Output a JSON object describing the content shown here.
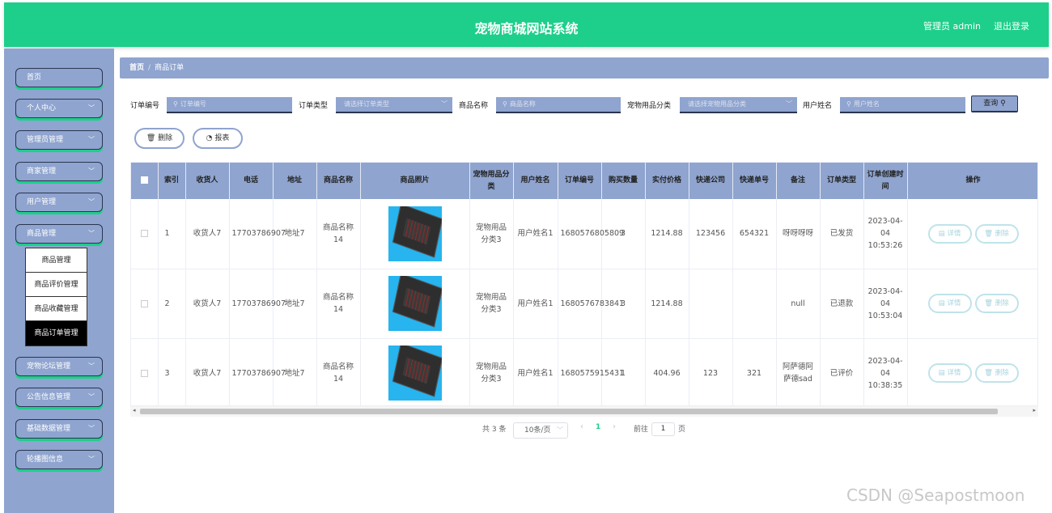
{
  "header": {
    "title": "宠物商城网站系统",
    "user": "管理员 admin",
    "logout": "退出登录"
  },
  "sidebar": {
    "items": [
      {
        "label": "首页",
        "chevron": ""
      },
      {
        "label": "个人中心",
        "chevron": "﹀"
      },
      {
        "label": "管理员管理",
        "chevron": "﹀"
      },
      {
        "label": "商家管理",
        "chevron": "﹀"
      },
      {
        "label": "用户管理",
        "chevron": "﹀"
      },
      {
        "label": "商品管理",
        "chevron": "﹀"
      },
      {
        "label": "宠物论坛管理",
        "chevron": "﹀"
      },
      {
        "label": "公告信息管理",
        "chevron": "﹀"
      },
      {
        "label": "基础数据管理",
        "chevron": "﹀"
      },
      {
        "label": "轮播图信息",
        "chevron": "﹀"
      }
    ],
    "submenu": [
      "商品管理",
      "商品评价管理",
      "商品收藏管理",
      "商品订单管理"
    ]
  },
  "breadcrumb": {
    "home": "首页",
    "sep": "/",
    "current": "商品订单"
  },
  "filters": {
    "order_no_label": "订单编号",
    "order_no_placeholder": "订单编号",
    "order_type_label": "订单类型",
    "order_type_placeholder": "请选择订单类型",
    "product_name_label": "商品名称",
    "product_name_placeholder": "商品名称",
    "category_label": "宠物用品分类",
    "category_placeholder": "请选择宠物用品分类",
    "username_label": "用户姓名",
    "username_placeholder": "用户姓名",
    "query_label": "查询",
    "search_icon": "⚲",
    "dropdown_icon": "﹀"
  },
  "actions": {
    "delete_label": "删除",
    "delete_icon": "🗑",
    "report_label": "报表",
    "report_icon": "◔"
  },
  "table": {
    "headers": [
      "索引",
      "收货人",
      "电话",
      "地址",
      "商品名称",
      "商品照片",
      "宠物用品分类",
      "用户姓名",
      "订单编号",
      "购买数量",
      "实付价格",
      "快递公司",
      "快递单号",
      "备注",
      "订单类型",
      "订单创建时间",
      "操作"
    ],
    "rows": [
      {
        "index": "1",
        "receiver": "收货人7",
        "phone": "17703786907",
        "address": "地址7",
        "product": "商品名称14",
        "category": "宠物用品分类3",
        "username": "用户姓名1",
        "order_no": "1680576805809",
        "qty": "3",
        "price": "1214.88",
        "courier": "123456",
        "tracking": "654321",
        "note": "呀呀呀呀",
        "type": "已发货",
        "created": "2023-04-04 10:53:26"
      },
      {
        "index": "2",
        "receiver": "收货人7",
        "phone": "17703786907",
        "address": "地址7",
        "product": "商品名称14",
        "category": "宠物用品分类3",
        "username": "用户姓名1",
        "order_no": "1680576783841",
        "qty": "3",
        "price": "1214.88",
        "courier": "",
        "tracking": "",
        "note": "null",
        "type": "已退款",
        "created": "2023-04-04 10:53:04"
      },
      {
        "index": "3",
        "receiver": "收货人7",
        "phone": "17703786907",
        "address": "地址7",
        "product": "商品名称14",
        "category": "宠物用品分类3",
        "username": "用户姓名1",
        "order_no": "1680575915431",
        "qty": "1",
        "price": "404.96",
        "courier": "123",
        "tracking": "321",
        "note": "阿萨德阿萨德sad",
        "type": "已评价",
        "created": "2023-04-04 10:38:35"
      }
    ],
    "detail_label": "详情",
    "detail_icon": "▤",
    "delete_label": "删除",
    "delete_icon": "🗑"
  },
  "pagination": {
    "total": "共 3 条",
    "page_size": "10条/页",
    "current": "1",
    "goto_label": "前往",
    "goto_value": "1",
    "page_suffix": "页",
    "prev": "‹",
    "next": "›"
  },
  "scrollbar": {
    "left": "◂",
    "right": "▸"
  },
  "watermark": "CSDN @Seapostmoon",
  "colors": {
    "primary": "#1dcf8a",
    "nav": "#8fa4cf",
    "dark_border": "#2a3550"
  }
}
